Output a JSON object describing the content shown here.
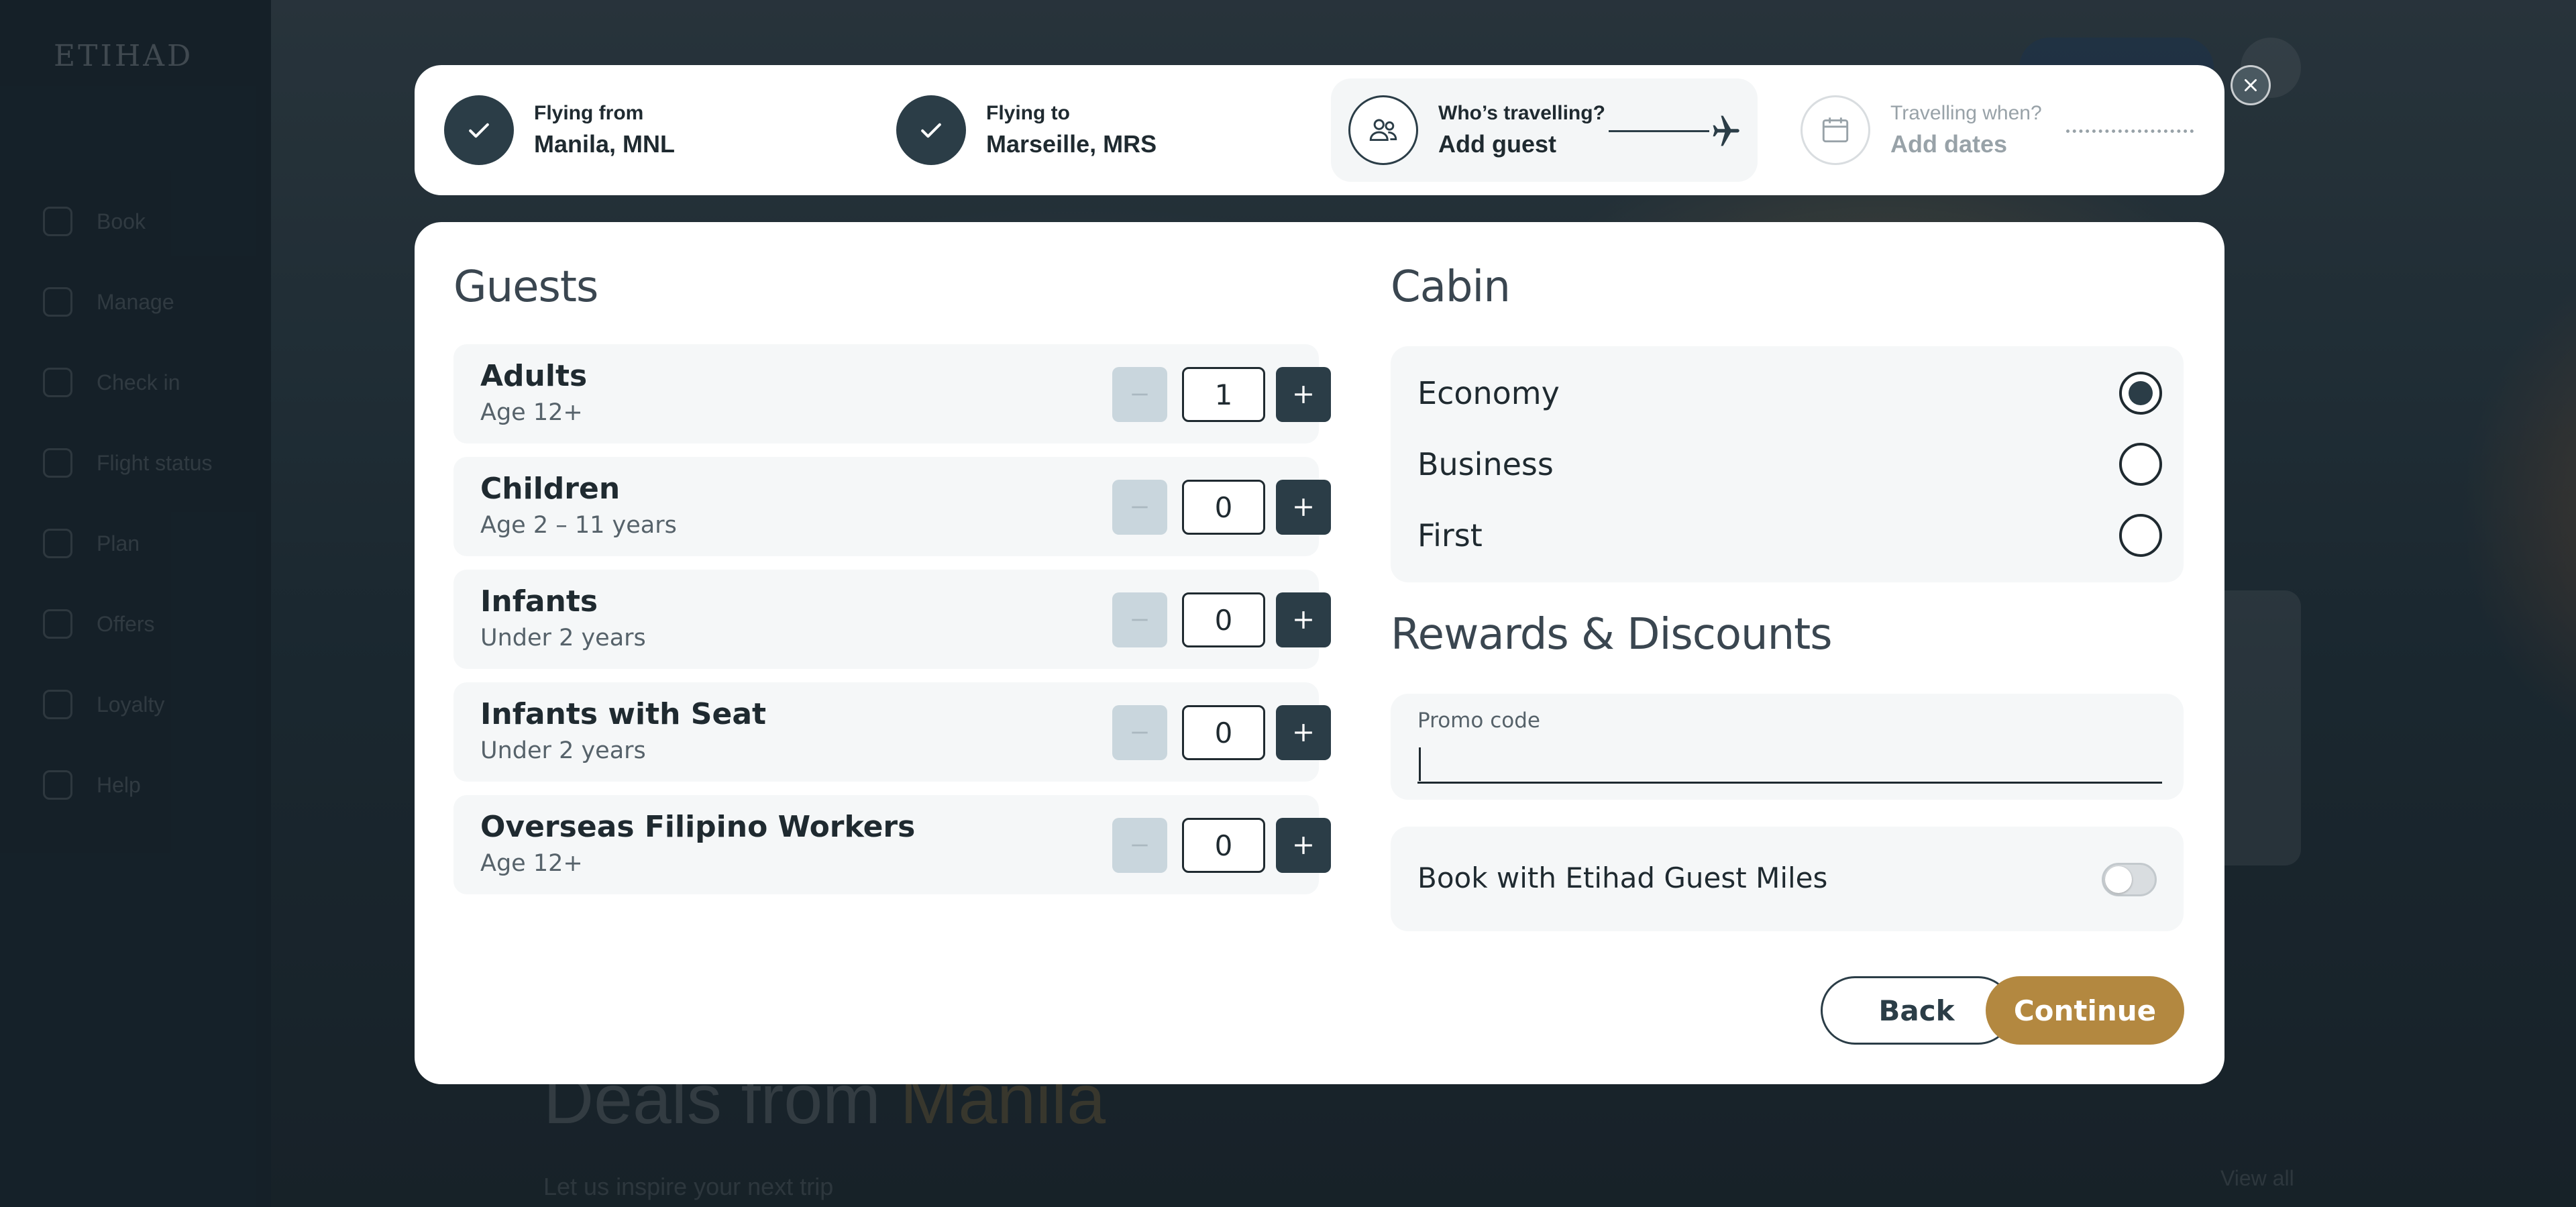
{
  "background": {
    "logo": "ETIHAD",
    "nav_items": [
      "Book",
      "Manage",
      "Check in",
      "Flight status",
      "Plan",
      "Offers",
      "Loyalty",
      "Help"
    ],
    "heading_plain": "Deals from ",
    "heading_accent": "Manila",
    "subheading": "Let us inspire your next trip",
    "view_all": "View all"
  },
  "stepper": {
    "from": {
      "label": "Flying from",
      "value": "Manila, MNL",
      "status": "complete"
    },
    "to": {
      "label": "Flying to",
      "value": "Marseille, MRS",
      "status": "complete"
    },
    "who": {
      "label": "Who’s travelling?",
      "value": "Add guest",
      "status": "active",
      "icon": "guests-icon"
    },
    "when": {
      "label": "Travelling when?",
      "value": "Add dates",
      "status": "pending",
      "icon": "calendar-icon"
    },
    "close_icon": "close-icon"
  },
  "guests": {
    "title": "Guests",
    "rows": [
      {
        "name": "Adults",
        "sub": "Age 12+",
        "count": "1"
      },
      {
        "name": "Children",
        "sub": "Age 2 – 11 years",
        "count": "0"
      },
      {
        "name": "Infants",
        "sub": "Under 2 years",
        "count": "0"
      },
      {
        "name": "Infants with Seat",
        "sub": "Under 2 years",
        "count": "0"
      },
      {
        "name": "Overseas Filipino Workers",
        "sub": "Age 12+",
        "count": "0"
      }
    ]
  },
  "cabin": {
    "title": "Cabin",
    "options": [
      {
        "label": "Economy",
        "selected": true
      },
      {
        "label": "Business",
        "selected": false
      },
      {
        "label": "First",
        "selected": false
      }
    ]
  },
  "rewards": {
    "title": "Rewards & Discounts",
    "promo_label": "Promo code",
    "promo_value": "",
    "miles_label": "Book with Etihad Guest Miles",
    "miles_enabled": false
  },
  "actions": {
    "back": "Back",
    "continue": "Continue"
  },
  "colors": {
    "primary": "#2b3d47",
    "accent_gold": "#b38840",
    "minus_disabled": "#c9d6dd",
    "panel_bg": "#f5f7f8"
  }
}
